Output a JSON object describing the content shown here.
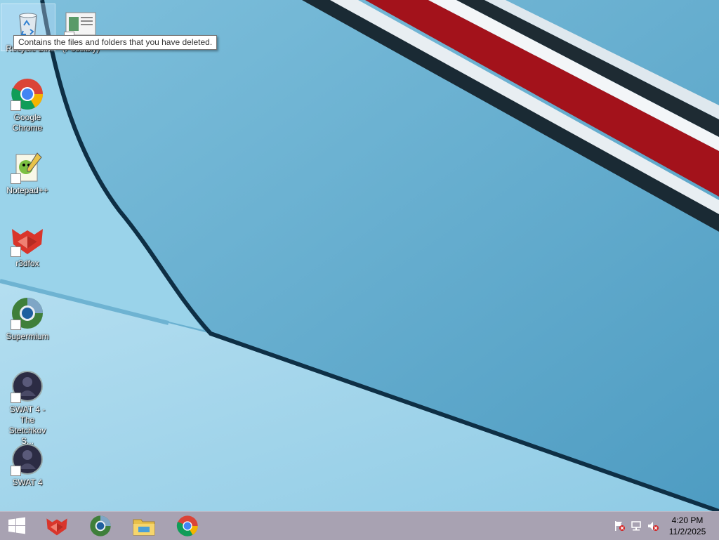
{
  "desktop": {
    "icons": [
      {
        "label": "Recycle Bin",
        "icon": "recycle-bin-icon"
      },
      {
        "label": "(Possibly)",
        "icon": "document-shortcut-icon"
      },
      {
        "label": "Google Chrome",
        "icon": "chrome-icon"
      },
      {
        "label": "Notepad++",
        "icon": "notepad-plus-plus-icon"
      },
      {
        "label": "r3dfox",
        "icon": "r3dfox-icon"
      },
      {
        "label": "Supermium",
        "icon": "supermium-icon"
      },
      {
        "label": "SWAT 4 - The Stetchkov S...",
        "icon": "swat4-tss-icon"
      },
      {
        "label": "SWAT 4",
        "icon": "swat4-icon"
      }
    ],
    "tooltip": "Contains the files and folders that you have deleted."
  },
  "taskbar": {
    "start_icon": "windows-logo-icon",
    "pinned": [
      {
        "name": "r3dfox",
        "icon": "r3dfox-icon"
      },
      {
        "name": "Supermium",
        "icon": "supermium-icon"
      },
      {
        "name": "File Explorer",
        "icon": "file-explorer-icon"
      },
      {
        "name": "Google Chrome",
        "icon": "chrome-icon"
      }
    ],
    "tray": {
      "icons": [
        "action-center-flag-icon",
        "network-icon",
        "volume-muted-icon"
      ],
      "time": "4:20 PM",
      "date": "11/2/2025"
    }
  },
  "colors": {
    "taskbar": "#a8a2b2",
    "tooltip_border": "#767676",
    "stripe_red": "#a3121b"
  }
}
